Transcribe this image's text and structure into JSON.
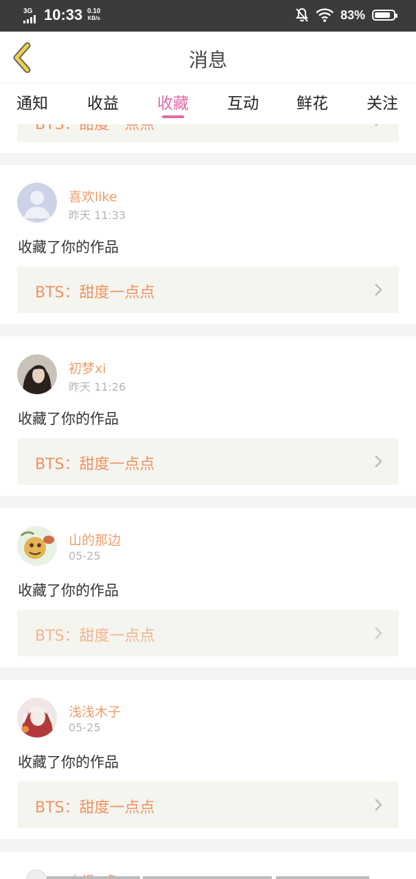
{
  "status_bar": {
    "network": "3G",
    "time": "10:33",
    "speed_value": "0.10",
    "speed_unit": "KB/s",
    "battery": "83%",
    "battery_level": 0.83
  },
  "header": {
    "back_icon": "chevron-left-icon",
    "title": "消息"
  },
  "tabs": [
    {
      "label": "通知",
      "active": false
    },
    {
      "label": "收益",
      "active": false
    },
    {
      "label": "收藏",
      "active": true
    },
    {
      "label": "互动",
      "active": false
    },
    {
      "label": "鲜花",
      "active": false
    },
    {
      "label": "关注",
      "active": false
    }
  ],
  "colors": {
    "accent": "#e06aa6",
    "username": "#ee9c6a",
    "work_title": "#f09262"
  },
  "partial_top": {
    "work": "BTS：甜度一点点"
  },
  "messages": [
    {
      "user": "喜欢like",
      "time": "昨天 11:33",
      "action": "收藏了你的作品",
      "work": "BTS：甜度一点点"
    },
    {
      "user": "初梦xi",
      "time": "昨天 11:26",
      "action": "收藏了你的作品",
      "work": "BTS：甜度一点点"
    },
    {
      "user": "山的那边",
      "time": "05-25",
      "action": "收藏了你的作品",
      "work": "BTS：甜度一点点"
    },
    {
      "user": "浅浅木子",
      "time": "05-25",
      "action": "收藏了你的作品",
      "work": "BTS：甜度一点点"
    }
  ],
  "partial_bottom": {
    "user": "小怪=鱼"
  }
}
